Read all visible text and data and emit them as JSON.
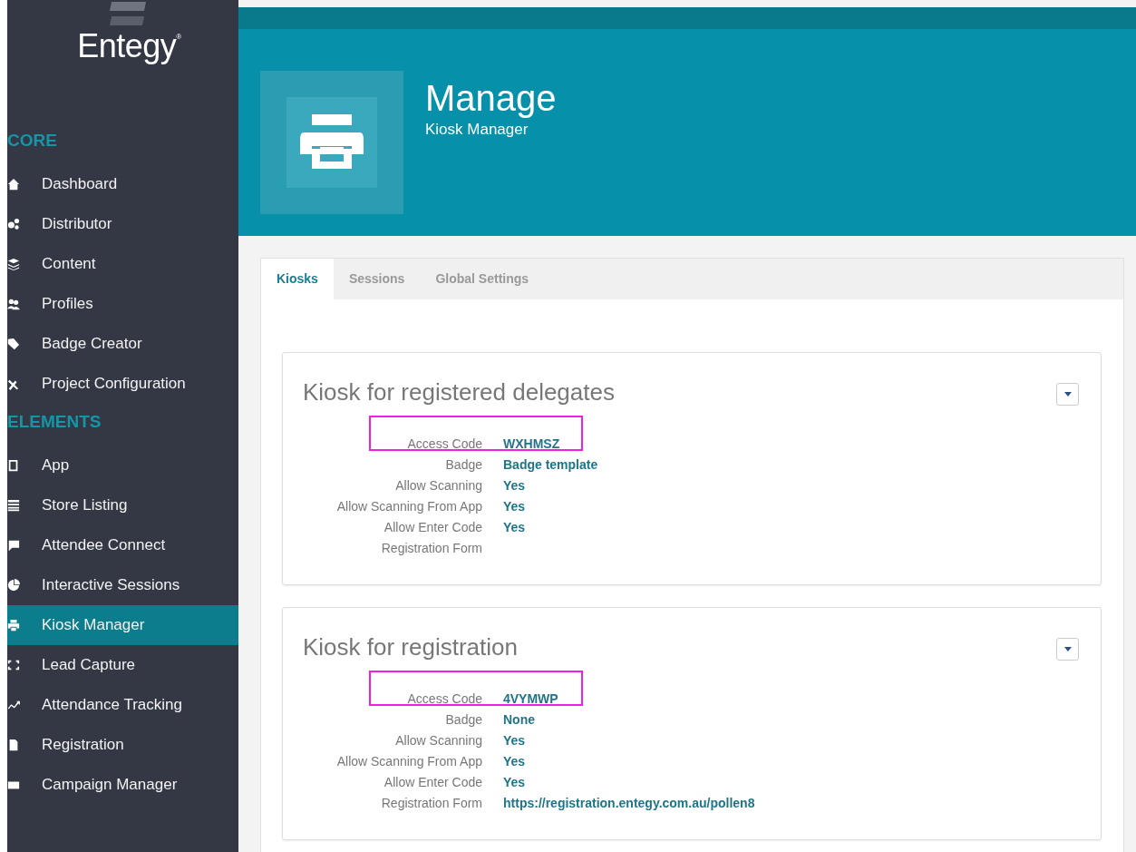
{
  "brand": {
    "name": "Entegy",
    "mark": "®"
  },
  "sidebar": {
    "sections": [
      {
        "title": "CORE",
        "items": [
          {
            "label": "Dashboard",
            "selected": false
          },
          {
            "label": "Distributor",
            "selected": false
          },
          {
            "label": "Content",
            "selected": false
          },
          {
            "label": "Profiles",
            "selected": false
          },
          {
            "label": "Badge Creator",
            "selected": false
          },
          {
            "label": "Project Configuration",
            "selected": false
          }
        ]
      },
      {
        "title": "ELEMENTS",
        "items": [
          {
            "label": "App",
            "selected": false
          },
          {
            "label": "Store Listing",
            "selected": false
          },
          {
            "label": "Attendee Connect",
            "selected": false
          },
          {
            "label": "Interactive Sessions",
            "selected": false
          },
          {
            "label": "Kiosk Manager",
            "selected": true
          },
          {
            "label": "Lead Capture",
            "selected": false
          },
          {
            "label": "Attendance Tracking",
            "selected": false
          },
          {
            "label": "Registration",
            "selected": false
          },
          {
            "label": "Campaign Manager",
            "selected": false
          }
        ]
      }
    ]
  },
  "header": {
    "title": "Manage",
    "subtitle": "Kiosk Manager"
  },
  "tabs": [
    {
      "label": "Kiosks",
      "selected": true
    },
    {
      "label": "Sessions",
      "selected": false
    },
    {
      "label": "Global Settings",
      "selected": false
    }
  ],
  "kiosks": [
    {
      "title": "Kiosk for registered delegates",
      "rows": [
        {
          "label": "Access Code",
          "value": "WXHMSZ",
          "highlighted": true
        },
        {
          "label": "Badge",
          "value": "Badge template",
          "highlighted": false
        },
        {
          "label": "Allow Scanning",
          "value": "Yes",
          "highlighted": false
        },
        {
          "label": "Allow Scanning From App",
          "value": "Yes",
          "highlighted": false
        },
        {
          "label": "Allow Enter Code",
          "value": "Yes",
          "highlighted": false
        },
        {
          "label": "Registration Form",
          "highlighted": false
        }
      ]
    },
    {
      "title": "Kiosk for registration",
      "rows": [
        {
          "label": "Access Code",
          "value": "4VYMWP",
          "highlighted": true
        },
        {
          "label": "Badge",
          "value": "None",
          "highlighted": false
        },
        {
          "label": "Allow Scanning",
          "value": "Yes",
          "highlighted": false
        },
        {
          "label": "Allow Scanning From App",
          "value": "Yes",
          "highlighted": false
        },
        {
          "label": "Allow Enter Code",
          "value": "Yes",
          "highlighted": false
        },
        {
          "label": "Registration Form",
          "value": "https://registration.entegy.com.au/pollen8",
          "highlighted": false
        }
      ]
    }
  ]
}
